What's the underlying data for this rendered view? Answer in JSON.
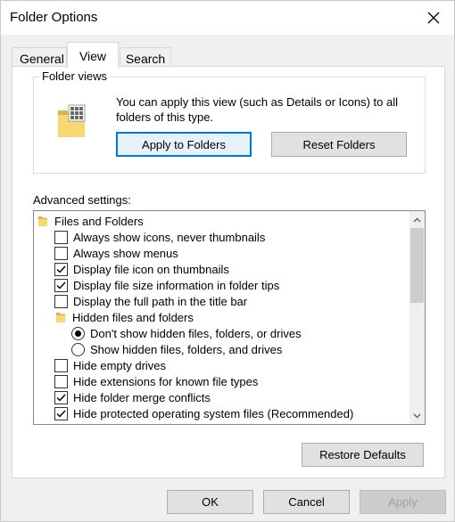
{
  "window": {
    "title": "Folder Options"
  },
  "tabs": [
    {
      "label": "General",
      "active": false
    },
    {
      "label": "View",
      "active": true
    },
    {
      "label": "Search",
      "active": false
    }
  ],
  "folder_views": {
    "group_label": "Folder views",
    "description": "You can apply this view (such as Details or Icons) to all folders of this type.",
    "apply_button": "Apply to Folders",
    "reset_button": "Reset Folders"
  },
  "advanced": {
    "label": "Advanced settings:",
    "items": [
      {
        "type": "folder",
        "label": "Files and Folders"
      },
      {
        "type": "checkbox",
        "label": "Always show icons, never thumbnails",
        "checked": false
      },
      {
        "type": "checkbox",
        "label": "Always show menus",
        "checked": false
      },
      {
        "type": "checkbox",
        "label": "Display file icon on thumbnails",
        "checked": true
      },
      {
        "type": "checkbox",
        "label": "Display file size information in folder tips",
        "checked": true
      },
      {
        "type": "checkbox",
        "label": "Display the full path in the title bar",
        "checked": false
      },
      {
        "type": "subfolder",
        "label": "Hidden files and folders"
      },
      {
        "type": "radio",
        "label": "Don't show hidden files, folders, or drives",
        "checked": true
      },
      {
        "type": "radio",
        "label": "Show hidden files, folders, and drives",
        "checked": false
      },
      {
        "type": "checkbox",
        "label": "Hide empty drives",
        "checked": false
      },
      {
        "type": "checkbox",
        "label": "Hide extensions for known file types",
        "checked": false
      },
      {
        "type": "checkbox",
        "label": "Hide folder merge conflicts",
        "checked": true
      },
      {
        "type": "checkbox",
        "label": "Hide protected operating system files (Recommended)",
        "checked": true
      }
    ],
    "restore_button": "Restore Defaults"
  },
  "footer": {
    "ok": "OK",
    "cancel": "Cancel",
    "apply": "Apply"
  },
  "colors": {
    "accent": "#0078d7",
    "folder": "#f8d775",
    "folder_dark": "#e0b34a"
  }
}
